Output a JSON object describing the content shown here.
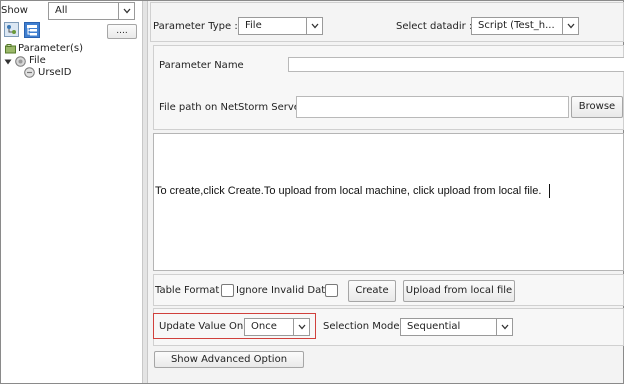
{
  "left": {
    "show_label": "Show",
    "show_value": "All",
    "more_label": "....",
    "tree": {
      "root_label": "Parameter(s)",
      "file_label": "File",
      "child_label": "UrseID"
    }
  },
  "right": {
    "param_type_label": "Parameter Type :",
    "param_type_value": "File",
    "datadir_label": "Select datadir :",
    "datadir_value": "Script (Test_h...",
    "param_name_label": "Parameter Name",
    "param_name_value": "",
    "file_path_label": "File path on NetStorm Server",
    "file_path_value": "",
    "browse_label": "Browse",
    "editor_text": "To create,click Create.To upload from local machine, click upload from local file.",
    "table_format_label": "Table Format",
    "ignore_invalid_label": "Ignore Invalid Data",
    "create_label": "Create",
    "upload_label": "Upload from local file",
    "update_value_label": "Update Value On",
    "update_value_value": "Once",
    "selection_mode_label": "Selection Mode",
    "selection_mode_value": "Sequential",
    "advanced_label": "Show Advanced Option"
  },
  "colors": {
    "highlight_border": "#d0403c",
    "panel_bg": "#f3f3f3"
  }
}
